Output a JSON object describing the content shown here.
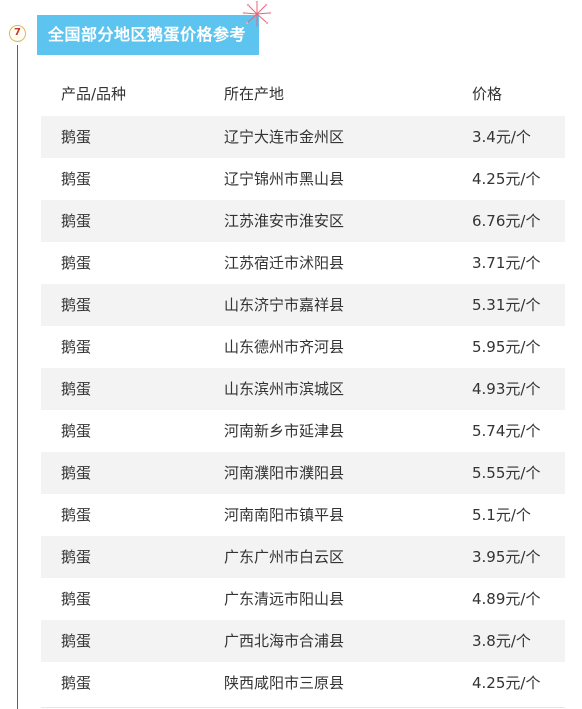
{
  "section": {
    "number": "7",
    "title": "全国部分地区鹅蛋价格参考"
  },
  "colors": {
    "title_bg": "#5cc4ee",
    "accent_line": "#c0392b",
    "badge_border": "#e2b84a",
    "stripe": "#f3f3f3"
  },
  "table": {
    "headers": [
      "产品/品种",
      "所在产地",
      "价格"
    ],
    "rows": [
      {
        "product": "鹅蛋",
        "origin": "辽宁大连市金州区",
        "price": "3.4元/个"
      },
      {
        "product": "鹅蛋",
        "origin": "辽宁锦州市黑山县",
        "price": "4.25元/个"
      },
      {
        "product": "鹅蛋",
        "origin": "江苏淮安市淮安区",
        "price": "6.76元/个"
      },
      {
        "product": "鹅蛋",
        "origin": "江苏宿迁市沭阳县",
        "price": "3.71元/个"
      },
      {
        "product": "鹅蛋",
        "origin": "山东济宁市嘉祥县",
        "price": "5.31元/个"
      },
      {
        "product": "鹅蛋",
        "origin": "山东德州市齐河县",
        "price": "5.95元/个"
      },
      {
        "product": "鹅蛋",
        "origin": "山东滨州市滨城区",
        "price": "4.93元/个"
      },
      {
        "product": "鹅蛋",
        "origin": "河南新乡市延津县",
        "price": "5.74元/个"
      },
      {
        "product": "鹅蛋",
        "origin": "河南濮阳市濮阳县",
        "price": "5.55元/个"
      },
      {
        "product": "鹅蛋",
        "origin": "河南南阳市镇平县",
        "price": "5.1元/个"
      },
      {
        "product": "鹅蛋",
        "origin": "广东广州市白云区",
        "price": "3.95元/个"
      },
      {
        "product": "鹅蛋",
        "origin": "广东清远市阳山县",
        "price": "4.89元/个"
      },
      {
        "product": "鹅蛋",
        "origin": "广西北海市合浦县",
        "price": "3.8元/个"
      },
      {
        "product": "鹅蛋",
        "origin": "陕西咸阳市三原县",
        "price": "4.25元/个"
      }
    ]
  }
}
